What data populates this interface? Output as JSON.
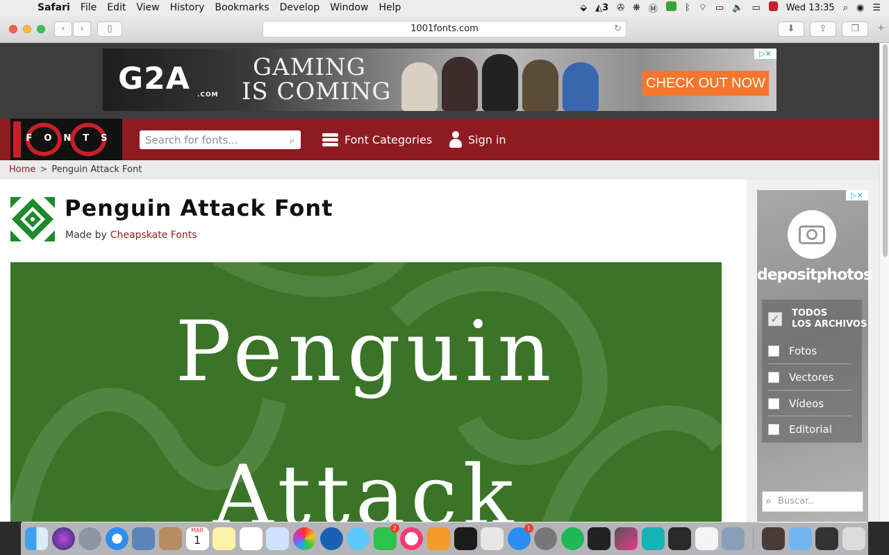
{
  "menubar": {
    "app": "Safari",
    "items": [
      "File",
      "Edit",
      "View",
      "History",
      "Bookmarks",
      "Develop",
      "Window",
      "Help"
    ],
    "clock": "Wed 13:35",
    "adobe_count": "3"
  },
  "browser": {
    "url": "1001fonts.com"
  },
  "ad_top": {
    "brand": "G2A",
    "brand_suffix": ".COM",
    "tagline_1": "GAMING",
    "tagline_2": "IS COMING",
    "cta": "CHECK OUT NOW",
    "adchoices": "▷✕"
  },
  "site": {
    "logo_text": "FONTS",
    "search_placeholder": "Search for fonts...",
    "nav": {
      "categories": "Font Categories",
      "signin": "Sign in"
    }
  },
  "breadcrumb": {
    "home": "Home",
    "separator": ">",
    "current": "Penguin Attack Font"
  },
  "font": {
    "title": "Penguin Attack Font",
    "made_by": "Made by",
    "author": "Cheapskate Fonts",
    "preview_line_1": "Penguin",
    "preview_line_2": "Attack",
    "preview_bg": "#3a7427"
  },
  "ad_side": {
    "brand": "depositphotos",
    "adchoices": "▷✕",
    "options": [
      {
        "label_1": "TODOS",
        "label_2": "LOS ARCHIVOS",
        "checked": true
      },
      {
        "label": "Fotos",
        "checked": false
      },
      {
        "label": "Vectores",
        "checked": false
      },
      {
        "label": "Vídeos",
        "checked": false
      },
      {
        "label": "Editorial",
        "checked": false
      }
    ],
    "search_placeholder": "Buscar.."
  },
  "dock": {
    "apps": [
      "finder",
      "siri",
      "launchpad",
      "safari",
      "mail-bird",
      "contacts",
      "calendar",
      "notes",
      "reminders",
      "preview",
      "photos",
      "sourcetree",
      "messages",
      "facetime",
      "itunes",
      "ibooks",
      "terminal",
      "unity",
      "app-store",
      "system-preferences",
      "spotify",
      "activity-monitor",
      "final-cut-pro",
      "maya",
      "epic-games",
      "textedit",
      "network-utility",
      "downloads",
      "folder",
      "screenshot",
      "trash"
    ],
    "badges": {
      "facetime": "2",
      "app-store": "1"
    },
    "calendar_month": "MAR",
    "calendar_day": "1"
  }
}
